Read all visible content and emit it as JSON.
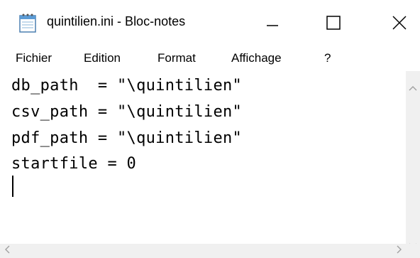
{
  "window": {
    "title": "quintilien.ini - Bloc-notes",
    "icon": "notepad-icon"
  },
  "window_controls": {
    "minimize_icon": "minimize-icon",
    "maximize_icon": "maximize-icon",
    "close_icon": "close-icon"
  },
  "menu": {
    "items": [
      {
        "label": "Fichier"
      },
      {
        "label": "Edition"
      },
      {
        "label": "Format"
      },
      {
        "label": "Affichage"
      },
      {
        "label": "?"
      }
    ]
  },
  "editor": {
    "lines": [
      "db_path  = \"\\quintilien\"",
      "csv_path = \"\\quintilien\"",
      "pdf_path = \"\\quintilien\"",
      "startfile = 0"
    ]
  },
  "scrollbars": {
    "up_icon": "chevron-up-icon",
    "down_icon": "chevron-down-icon",
    "left_icon": "chevron-left-icon",
    "right_icon": "chevron-right-icon"
  }
}
